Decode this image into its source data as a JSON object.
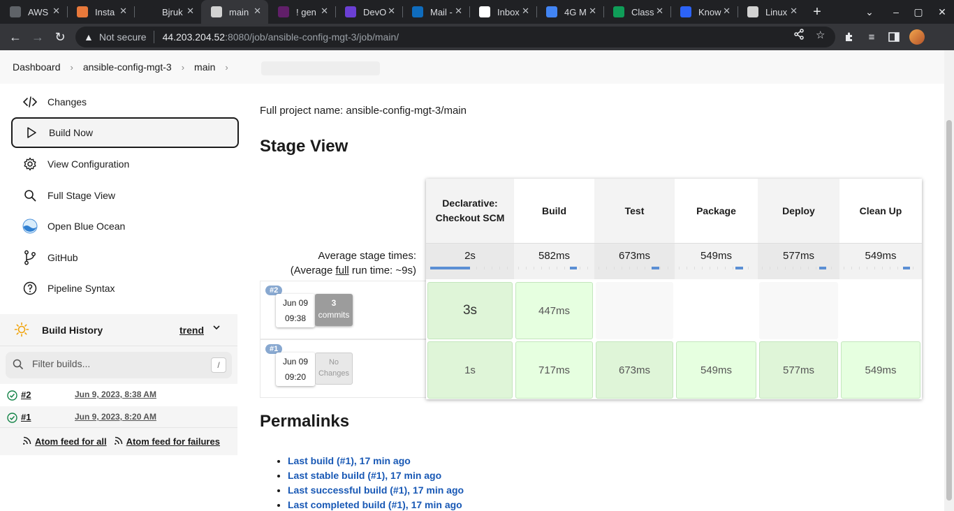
{
  "browser": {
    "tabs": [
      {
        "title": "AWS",
        "color": "#5f6368",
        "glyph": "globe-icon",
        "active": false
      },
      {
        "title": "Insta",
        "color": "#e8793b",
        "glyph": "instance-icon",
        "active": false
      },
      {
        "title": "Bjruk",
        "color": "#202124",
        "glyph": "github-icon",
        "active": false
      },
      {
        "title": "main",
        "color": "#d2d2d2",
        "glyph": "jenkins-icon",
        "active": true
      },
      {
        "title": "! gen",
        "color": "#611f69",
        "glyph": "slack-icon",
        "active": false
      },
      {
        "title": "DevO",
        "color": "#6b3fd4",
        "glyph": "devops-icon",
        "active": false
      },
      {
        "title": "Mail -",
        "color": "#0f6cbd",
        "glyph": "outlook-icon",
        "active": false
      },
      {
        "title": "Inbox",
        "color": "#ffffff",
        "glyph": "gmail-icon",
        "active": false
      },
      {
        "title": "4G M",
        "color": "#4285f4",
        "glyph": "google-icon",
        "active": false
      },
      {
        "title": "Class",
        "color": "#0f9d58",
        "glyph": "classroom-icon",
        "active": false
      },
      {
        "title": "Know",
        "color": "#2c63f6",
        "glyph": "zoom-icon",
        "active": false
      },
      {
        "title": "Linux",
        "color": "#d2d2d2",
        "glyph": "person-icon",
        "active": false
      }
    ],
    "security": "Not secure",
    "url_host": "44.203.204.52",
    "url_path": ":8080/job/ansible-config-mgt-3/job/main/"
  },
  "breadcrumbs": [
    "Dashboard",
    "ansible-config-mgt-3",
    "main"
  ],
  "sidebar": {
    "tasks": [
      {
        "label": "Changes",
        "icon": "code-icon"
      },
      {
        "label": "Build Now",
        "icon": "play-icon"
      },
      {
        "label": "View Configuration",
        "icon": "gear-icon"
      },
      {
        "label": "Full Stage View",
        "icon": "search-icon"
      },
      {
        "label": "Open Blue Ocean",
        "icon": "blue-ocean-icon"
      },
      {
        "label": "GitHub",
        "icon": "branch-icon"
      },
      {
        "label": "Pipeline Syntax",
        "icon": "help-icon"
      }
    ]
  },
  "build_history": {
    "title": "Build History",
    "trend": "trend",
    "filter_placeholder": "Filter builds...",
    "filter_shortcut": "/",
    "builds": [
      {
        "number": "#2",
        "date": "Jun 9, 2023, 8:38 AM",
        "status": "success"
      },
      {
        "number": "#1",
        "date": "Jun 9, 2023, 8:20 AM",
        "status": "success"
      }
    ],
    "feed_all": "Atom feed for all",
    "feed_failures": "Atom feed for failures"
  },
  "main": {
    "full_project_name": "Full project name: ansible-config-mgt-3/main",
    "stage_view_title": "Stage View",
    "avg_line1": "Average stage times:",
    "avg_line2_pre": "(Average ",
    "avg_line2_full": "full",
    "avg_line2_post": " run time: ~9s)",
    "stages": [
      {
        "name": "Declarative: Checkout SCM",
        "avg": "2s",
        "bar_fill": 0.5
      },
      {
        "name": "Build",
        "avg": "582ms",
        "bar_fill": 0.1
      },
      {
        "name": "Test",
        "avg": "673ms",
        "bar_fill": 0.1
      },
      {
        "name": "Package",
        "avg": "549ms",
        "bar_fill": 0.1
      },
      {
        "name": "Deploy",
        "avg": "577ms",
        "bar_fill": 0.1
      },
      {
        "name": "Clean Up",
        "avg": "549ms",
        "bar_fill": 0.1
      }
    ],
    "runs": [
      {
        "badge": "#2",
        "date": "Jun 09",
        "time": "09:38",
        "commits_count": "3",
        "commits_label": "commits",
        "cells": [
          "3s",
          "447ms",
          "",
          "",
          "",
          ""
        ]
      },
      {
        "badge": "#1",
        "date": "Jun 09",
        "time": "09:20",
        "commits_count": "",
        "commits_label": "No Changes",
        "cells": [
          "1s",
          "717ms",
          "673ms",
          "549ms",
          "577ms",
          "549ms"
        ]
      }
    ],
    "permalinks_title": "Permalinks",
    "permalinks": [
      "Last build (#1), 17 min ago",
      "Last stable build (#1), 17 min ago",
      "Last successful build (#1), 17 min ago",
      "Last completed build (#1), 17 min ago"
    ]
  },
  "colors": {
    "link": "#1858b5",
    "success_cell": "#e6ffe0",
    "progress": "#5b8fd4",
    "success_icon": "#138347"
  }
}
